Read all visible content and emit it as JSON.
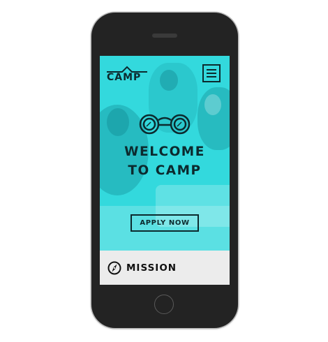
{
  "header": {
    "logo_text": "CAMP",
    "menu_icon": "hamburger-icon"
  },
  "hero": {
    "icon": "binoculars-icon",
    "headline_line1": "WELCOME",
    "headline_line2": "TO CAMP",
    "apply_label": "APPLY NOW",
    "overlay_color": "#33d9dd"
  },
  "section": {
    "icon": "compass-icon",
    "label": "MISSION"
  },
  "colors": {
    "ink": "#0c2a2e",
    "device": "#232323",
    "section_bg": "#ececec"
  }
}
